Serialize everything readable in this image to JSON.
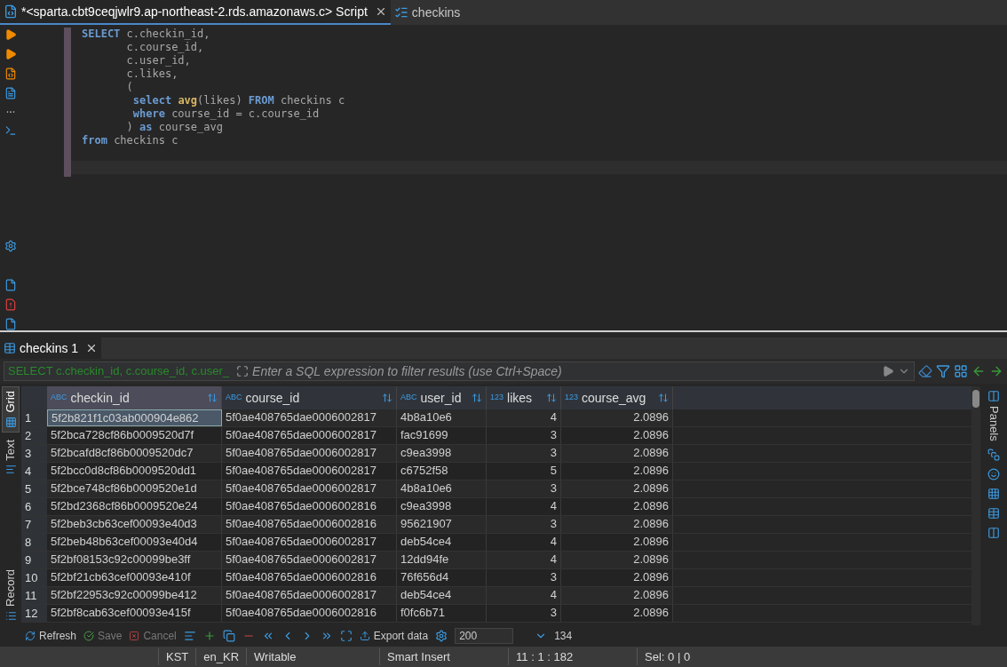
{
  "editor_tabs": [
    {
      "label": "*<sparta.cbt9ceqjwlr9.ap-northeast-2.rds.amazonaws.c> Script",
      "selected": true
    },
    {
      "label": "checkins",
      "selected": false
    }
  ],
  "code_lines": [
    [
      {
        "kind": "keyword",
        "text": "SELECT"
      },
      {
        "kind": "plain",
        "text": " c.checkin_id,"
      }
    ],
    [
      {
        "kind": "plain",
        "text": "       c.course_id,"
      }
    ],
    [
      {
        "kind": "plain",
        "text": "       c.user_id,"
      }
    ],
    [
      {
        "kind": "plain",
        "text": "       c.likes,"
      }
    ],
    [
      {
        "kind": "plain",
        "text": "       ("
      }
    ],
    [
      {
        "kind": "keyword",
        "text": "select ",
        "nested": true
      },
      {
        "kind": "function",
        "text": "avg"
      },
      {
        "kind": "plain",
        "text": "(likes) "
      },
      {
        "kind": "keyword",
        "text": "FROM"
      },
      {
        "kind": "plain",
        "text": " checkins c"
      }
    ],
    [
      {
        "kind": "keyword",
        "text": "where",
        "nested": true
      },
      {
        "kind": "plain",
        "text": " course_id = c.course_id"
      }
    ],
    [
      {
        "kind": "plain",
        "text": "       ) "
      },
      {
        "kind": "keyword",
        "text": "as"
      },
      {
        "kind": "plain",
        "text": " course_avg"
      }
    ],
    [
      {
        "kind": "keyword",
        "text": "from"
      },
      {
        "kind": "plain",
        "text": " checkins c"
      }
    ]
  ],
  "results_tab": {
    "label": "checkins 1"
  },
  "filter": {
    "query": "SELECT c.checkin_id, c.course_id, c.user_",
    "placeholder": "Enter a SQL expression to filter results (use Ctrl+Space)"
  },
  "view_tabs": [
    {
      "label": "Grid",
      "selected": true
    },
    {
      "label": "Text",
      "selected": false
    },
    {
      "label": "Record",
      "selected": false
    }
  ],
  "table": {
    "columns": [
      {
        "type": "ABC",
        "kind": "text",
        "name": "checkin_id",
        "selected": true
      },
      {
        "type": "ABC",
        "kind": "text",
        "name": "course_id",
        "selected": false
      },
      {
        "type": "ABC",
        "kind": "text",
        "name": "user_id",
        "selected": false
      },
      {
        "type": "123",
        "kind": "number",
        "name": "likes",
        "selected": false
      },
      {
        "type": "123",
        "kind": "number",
        "name": "course_avg",
        "selected": false
      }
    ],
    "rows": [
      {
        "num": "1",
        "selected": true,
        "cells": [
          "5f2b821f1c03ab000904e862",
          "5f0ae408765dae0006002817",
          "4b8a10e6",
          "4",
          "2.0896"
        ]
      },
      {
        "num": "2",
        "selected": false,
        "cells": [
          "5f2bca728cf86b0009520d7f",
          "5f0ae408765dae0006002817",
          "fac91699",
          "3",
          "2.0896"
        ]
      },
      {
        "num": "3",
        "selected": false,
        "cells": [
          "5f2bcafd8cf86b0009520dc7",
          "5f0ae408765dae0006002817",
          "c9ea3998",
          "3",
          "2.0896"
        ]
      },
      {
        "num": "4",
        "selected": false,
        "cells": [
          "5f2bcc0d8cf86b0009520dd1",
          "5f0ae408765dae0006002817",
          "c6752f58",
          "5",
          "2.0896"
        ]
      },
      {
        "num": "5",
        "selected": false,
        "cells": [
          "5f2bce748cf86b0009520e1d",
          "5f0ae408765dae0006002817",
          "4b8a10e6",
          "3",
          "2.0896"
        ]
      },
      {
        "num": "6",
        "selected": false,
        "cells": [
          "5f2bd2368cf86b0009520e24",
          "5f0ae408765dae0006002816",
          "c9ea3998",
          "4",
          "2.0896"
        ]
      },
      {
        "num": "7",
        "selected": false,
        "cells": [
          "5f2beb3cb63cef00093e40d3",
          "5f0ae408765dae0006002816",
          "95621907",
          "3",
          "2.0896"
        ]
      },
      {
        "num": "8",
        "selected": false,
        "cells": [
          "5f2beb48b63cef00093e40d4",
          "5f0ae408765dae0006002817",
          "deb54ce4",
          "4",
          "2.0896"
        ]
      },
      {
        "num": "9",
        "selected": false,
        "cells": [
          "5f2bf08153c92c00099be3ff",
          "5f0ae408765dae0006002817",
          "12dd94fe",
          "4",
          "2.0896"
        ]
      },
      {
        "num": "10",
        "selected": false,
        "cells": [
          "5f2bf21cb63cef00093e410f",
          "5f0ae408765dae0006002816",
          "76f656d4",
          "3",
          "2.0896"
        ]
      },
      {
        "num": "11",
        "selected": false,
        "cells": [
          "5f2bf22953c92c00099be412",
          "5f0ae408765dae0006002817",
          "deb54ce4",
          "4",
          "2.0896"
        ]
      },
      {
        "num": "12",
        "selected": false,
        "cells": [
          "5f2bf8cab63cef00093e415f",
          "5f0ae408765dae0006002816",
          "f0fc6b71",
          "3",
          "2.0896"
        ]
      }
    ]
  },
  "side_panel": {
    "label": "Panels"
  },
  "toolbar": {
    "refresh": "Refresh",
    "save": {
      "label": "Save",
      "disabled": true
    },
    "cancel": {
      "label": "Cancel",
      "disabled": true
    },
    "export": "Export data",
    "fetch_size": "200",
    "row_count": "134"
  },
  "status_bar": [
    "KST",
    "en_KR",
    "Writable",
    "Smart Insert",
    "11 : 1 : 182",
    "Sel: 0 | 0"
  ]
}
